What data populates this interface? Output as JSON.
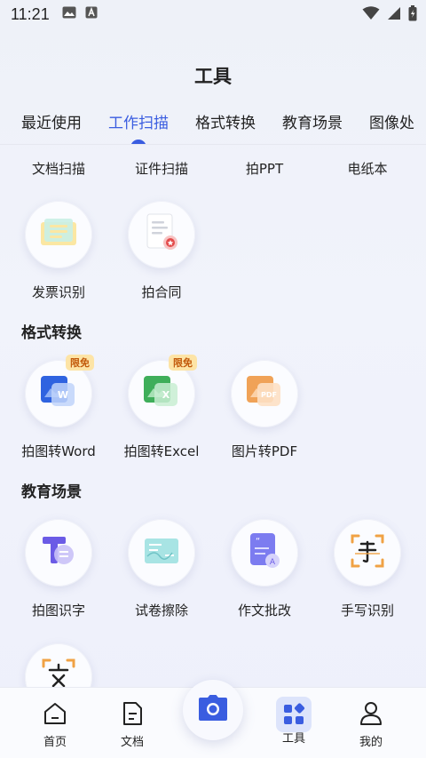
{
  "status_bar": {
    "time": "11:21"
  },
  "header": {
    "title": "工具"
  },
  "tabs": [
    {
      "label": "最近使用"
    },
    {
      "label": "工作扫描"
    },
    {
      "label": "格式转换"
    },
    {
      "label": "教育场景"
    },
    {
      "label": "图像处"
    }
  ],
  "work_scan": {
    "items": [
      {
        "label": "文档扫描"
      },
      {
        "label": "证件扫描"
      },
      {
        "label": "拍PPT"
      },
      {
        "label": "电纸本"
      },
      {
        "label": "发票识别"
      },
      {
        "label": "拍合同"
      }
    ]
  },
  "format_convert": {
    "title": "格式转换",
    "items": [
      {
        "label": "拍图转Word",
        "badge": "限免"
      },
      {
        "label": "拍图转Excel",
        "badge": "限免"
      },
      {
        "label": "图片转PDF"
      }
    ]
  },
  "education": {
    "title": "教育场景",
    "items": [
      {
        "label": "拍图识字"
      },
      {
        "label": "试卷擦除"
      },
      {
        "label": "作文批改"
      },
      {
        "label": "手写识别"
      }
    ]
  },
  "bottom_nav": [
    {
      "label": "首页"
    },
    {
      "label": "文档"
    },
    {
      "label": "工具"
    },
    {
      "label": "我的"
    }
  ],
  "colors": {
    "accent": "#3a5de0",
    "badge_bg": "#fde4a6",
    "badge_text": "#c2590a"
  }
}
